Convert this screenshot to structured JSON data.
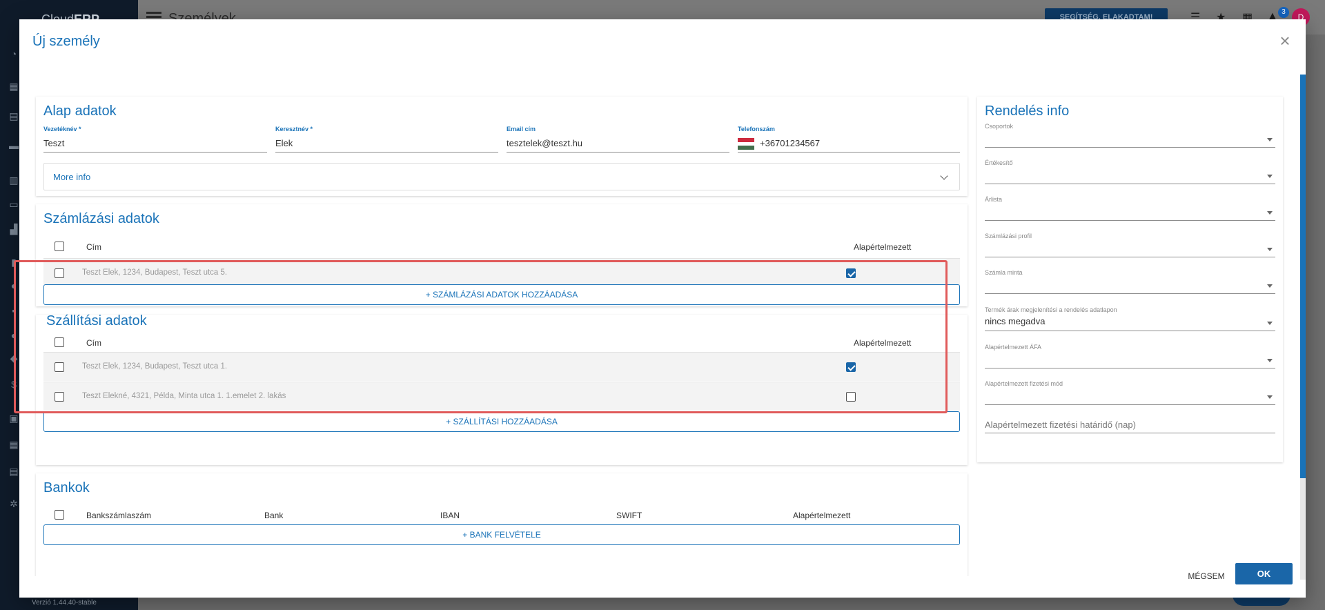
{
  "background": {
    "brand_plain": "Cloud",
    "brand_bold": "ERP",
    "page_title": "Személyek",
    "help_button": "SEGÍTSÉG, ELAKADTAM!",
    "notification_count": "3",
    "avatar_initial": "D",
    "version": "Verzió 1.44.40-stable"
  },
  "dialog": {
    "title": "Új személy",
    "close": "×",
    "cancel_label": "MÉGSEM",
    "ok_label": "OK"
  },
  "basic": {
    "title": "Alap adatok",
    "last_name": {
      "label": "Vezetéknév *",
      "value": "Teszt"
    },
    "first_name": {
      "label": "Keresztnév *",
      "value": "Elek"
    },
    "email": {
      "label": "Email cím",
      "value": "tesztelek@teszt.hu"
    },
    "phone": {
      "label": "Telefonszám",
      "value": "+36701234567"
    },
    "more_info": "More info"
  },
  "billing": {
    "title": "Számlázási adatok",
    "col_address": "Cím",
    "col_default": "Alapértelmezett",
    "rows": [
      {
        "address": "Teszt  Elek, 1234, Budapest, Teszt utca 5.",
        "default": true
      }
    ],
    "add_label": "+ SZÁMLÁZÁSI ADATOK HOZZÁADÁSA"
  },
  "shipping": {
    "title": "Szállítási adatok",
    "col_address": "Cím",
    "col_default": "Alapértelmezett",
    "rows": [
      {
        "address": "Teszt Elek, 1234, Budapest, Teszt utca 1.",
        "default": true
      },
      {
        "address": "Teszt  Elekné, 4321, Példa, Minta utca 1.  1.emelet 2. lakás",
        "default": false
      }
    ],
    "add_label": "+ SZÁLLÍTÁSI HOZZÁADÁSA"
  },
  "banks": {
    "title": "Bankok",
    "col_account": "Bankszámlaszám",
    "col_bank": "Bank",
    "col_iban": "IBAN",
    "col_swift": "SWIFT",
    "col_default": "Alapértelmezett",
    "add_label": "+ BANK FELVÉTELE"
  },
  "order_info": {
    "title": "Rendelés info",
    "groups": {
      "label": "Csoportok",
      "value": ""
    },
    "seller": {
      "label": "Értékesítő",
      "value": ""
    },
    "price_list": {
      "label": "Árlista",
      "value": ""
    },
    "billing_profile": {
      "label": "Számlázási profil",
      "value": ""
    },
    "invoice_template": {
      "label": "Számla minta",
      "value": ""
    },
    "price_display": {
      "label": "Termék árak megjelenítési a rendelés adatlapon",
      "value": "nincs megadva"
    },
    "default_vat": {
      "label": "Alapértelmezett ÁFA",
      "value": ""
    },
    "default_payment": {
      "label": "Alapértelmezett fizetési mód",
      "value": ""
    },
    "payment_deadline_placeholder": "Alapértelmezett fizetési határidő (nap)"
  },
  "colors": {
    "accent": "#1a73b8",
    "highlight": "#e05a5a",
    "checkbox_checked": "#1a66a8"
  }
}
